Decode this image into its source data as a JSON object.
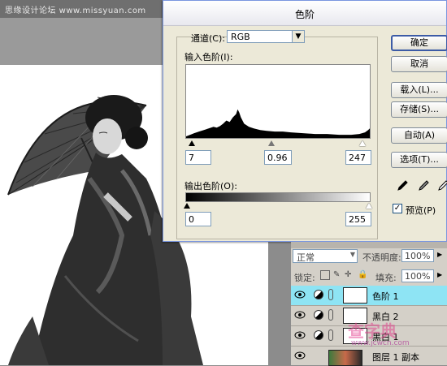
{
  "workspace": {
    "watermark": "思缘设计论坛 www.missyuan.com"
  },
  "dialog": {
    "title": "色阶",
    "channel_label": "通道(C):",
    "channel_value": "RGB",
    "input_levels_label": "输入色阶(I):",
    "input_black": "7",
    "input_gamma": "0.96",
    "input_white": "247",
    "output_levels_label": "输出色阶(O):",
    "output_black": "0",
    "output_white": "255",
    "buttons": {
      "ok": "确定",
      "cancel": "取消",
      "load": "载入(L)...",
      "save": "存储(S)...",
      "auto": "自动(A)",
      "options": "选项(T)..."
    },
    "preview_label": "预览(P)",
    "preview_checked": true
  },
  "layers": {
    "blend_mode": "正常",
    "opacity_label": "不透明度:",
    "opacity_value": "100%",
    "lock_label": "锁定:",
    "fill_label": "填充:",
    "fill_value": "100%",
    "items": [
      {
        "name": "色阶 1",
        "selected": true
      },
      {
        "name": "黑白 2",
        "selected": false
      },
      {
        "name": "黑白 1",
        "selected": false
      },
      {
        "name": "图层 1 副本",
        "selected": false
      }
    ]
  },
  "overlay_watermark": {
    "line1": "查字典",
    "line2": "www.jcwcn.com"
  },
  "colors": {
    "selected_layer": "#8ee4f4",
    "dialog_bg": "#ece9d8",
    "default_button_border": "#3c5ba6"
  }
}
